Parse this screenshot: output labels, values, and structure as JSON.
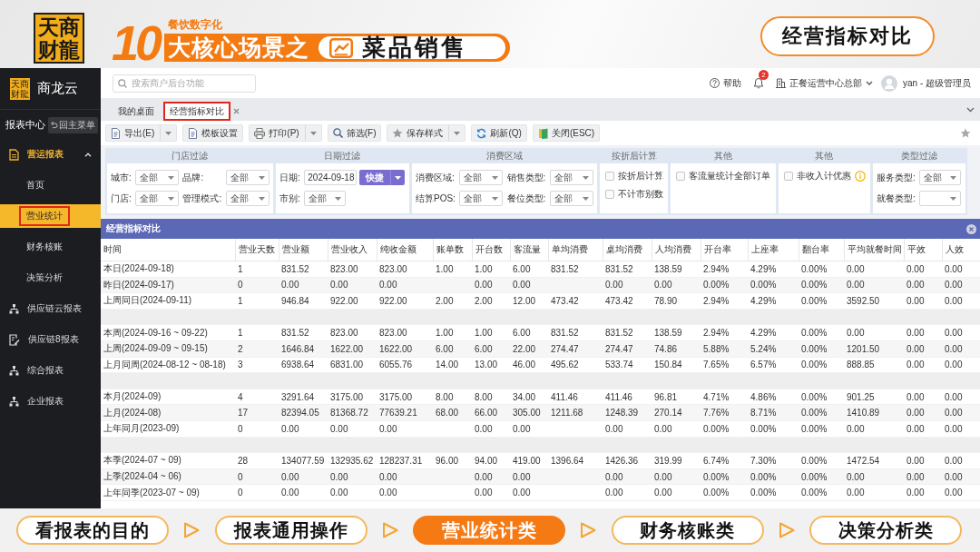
{
  "banner": {
    "logo_lines": [
      "天商",
      "财龍"
    ],
    "kicker": "餐饮数字化",
    "number": "10",
    "headline": "大核心场景之",
    "topic": "菜品销售",
    "badge": "经营指标对比"
  },
  "sidebar": {
    "logo_lines": [
      "天商",
      "财龍"
    ],
    "brand": "商龙云",
    "section_title": "报表中心",
    "back_button": "回主菜单",
    "items": [
      {
        "label": "营运报表",
        "kind": "report",
        "expanded": true,
        "children": [
          {
            "label": "首页",
            "selected": false,
            "highlighted": false
          },
          {
            "label": "营业统计",
            "selected": true,
            "highlighted": true
          },
          {
            "label": "财务核账",
            "selected": false,
            "highlighted": false
          },
          {
            "label": "决策分析",
            "selected": false,
            "highlighted": false
          }
        ]
      },
      {
        "label": "供应链云报表",
        "kind": "tree",
        "expanded": false
      },
      {
        "label": "供应链8报表",
        "kind": "form",
        "expanded": false
      },
      {
        "label": "综合报表",
        "kind": "tree",
        "expanded": false
      },
      {
        "label": "企业报表",
        "kind": "tree",
        "expanded": false
      }
    ]
  },
  "header": {
    "search": {
      "placeholder": "搜索商户后台功能"
    },
    "help": "帮助",
    "notifications": "2",
    "organization": "正餐运营中心总部",
    "user": "yan - 超级管理员"
  },
  "tabs": [
    {
      "label": "我的桌面",
      "selected": false,
      "highlighted": false
    },
    {
      "label": "经营指标对比",
      "selected": true,
      "highlighted": true
    }
  ],
  "toolbar": [
    {
      "label": "导出(E)",
      "kind": "export",
      "dropdown": true
    },
    {
      "label": "模板设置",
      "kind": "template",
      "dropdown": false
    },
    {
      "label": "打印(P)",
      "kind": "print",
      "dropdown": true
    },
    {
      "label": "筛选(F)",
      "kind": "filter",
      "dropdown": false
    },
    {
      "label": "保存样式",
      "kind": "save",
      "dropdown": true
    },
    {
      "label": "刷新(Q)",
      "kind": "refresh",
      "dropdown": false
    },
    {
      "label": "关闭(ESC)",
      "kind": "close",
      "dropdown": false
    }
  ],
  "filters": [
    {
      "title": "门店过滤",
      "fields": [
        {
          "kind": "select",
          "label": "城市:",
          "value": "全部"
        },
        {
          "kind": "select",
          "label": "品牌:",
          "value": "全部"
        },
        {
          "kind": "select",
          "label": "门店:",
          "value": "全部"
        },
        {
          "kind": "select",
          "label": "管理模式:",
          "value": "全部"
        }
      ]
    },
    {
      "title": "日期过滤",
      "fields": [
        {
          "kind": "date",
          "label": "日期:",
          "value": "2024-09-18",
          "button": "快捷"
        },
        {
          "kind": "select",
          "label": "市别:",
          "value": "全部"
        }
      ]
    },
    {
      "title": "消费区域",
      "fields": [
        {
          "kind": "select",
          "label": "消费区域:",
          "value": "全部"
        },
        {
          "kind": "select",
          "label": "销售类型:",
          "value": "全部"
        },
        {
          "kind": "select",
          "label": "结算POS:",
          "value": "全部"
        },
        {
          "kind": "select",
          "label": "餐位类型:",
          "value": "全部"
        }
      ]
    },
    {
      "title": "按折后计算",
      "fields": [
        {
          "kind": "checkbox",
          "label": "按折后计算",
          "checked": false
        },
        {
          "kind": "checkbox",
          "label": "不计市别数",
          "checked": false
        }
      ]
    },
    {
      "title": "其他",
      "fields": [
        {
          "kind": "checkbox",
          "label": "客流量统计全部订单",
          "checked": false
        }
      ]
    },
    {
      "title": "其他",
      "fields": [
        {
          "kind": "checkbox",
          "label": "非收入计优惠",
          "checked": false,
          "info": true
        }
      ]
    },
    {
      "title": "类型过滤",
      "fields": [
        {
          "kind": "select",
          "label": "服务类型:",
          "value": "全部"
        },
        {
          "kind": "select",
          "label": "就餐类型:"
        }
      ]
    }
  ],
  "table": {
    "title": "经营指标对比",
    "columns": [
      "时间",
      "营业天数",
      "营业额",
      "营业收入",
      "纯收金额",
      "账单数",
      "开台数",
      "客流量",
      "单均消费",
      "桌均消费",
      "人均消费",
      "开台率",
      "上座率",
      "翻台率",
      "平均就餐时间",
      "平效",
      "人效"
    ],
    "row_groups": [
      [
        {
          "time": "本日(2024-09-18)",
          "days": "1",
          "sales": "831.52",
          "income": "823.00",
          "net": "823.00",
          "bills": "1.00",
          "tables": "1.00",
          "guests": "6.00",
          "per_bill": "831.52",
          "per_table": "831.52",
          "per_guest": "138.59",
          "open_rate": "2.94%",
          "seat_rate": "4.29%",
          "turn_rate": "0.00%",
          "dining_time": "0.00",
          "area_eff": "0.00",
          "staff_eff": "0.00"
        },
        {
          "time": "昨日(2024-09-17)",
          "days": "0",
          "sales": "0.00",
          "income": "0.00",
          "net": "0.00",
          "tables": "0.00",
          "guests": "0.00",
          "per_table": "0.00",
          "per_guest": "0.00",
          "open_rate": "0.00%",
          "seat_rate": "0.00%",
          "turn_rate": "0.00%",
          "dining_time": "0.00",
          "area_eff": "0.00",
          "staff_eff": "0.00"
        },
        {
          "time": "上周同日(2024-09-11)",
          "days": "1",
          "sales": "946.84",
          "income": "922.00",
          "net": "922.00",
          "bills": "2.00",
          "tables": "2.00",
          "guests": "12.00",
          "per_bill": "473.42",
          "per_table": "473.42",
          "per_guest": "78.90",
          "open_rate": "2.94%",
          "seat_rate": "4.29%",
          "turn_rate": "0.00%",
          "dining_time": "3592.50",
          "area_eff": "0.00",
          "staff_eff": "0.00"
        }
      ],
      [
        {
          "time": "本周(2024-09-16 ~ 09-22)",
          "days": "1",
          "sales": "831.52",
          "income": "823.00",
          "net": "823.00",
          "bills": "1.00",
          "tables": "1.00",
          "guests": "6.00",
          "per_bill": "831.52",
          "per_table": "831.52",
          "per_guest": "138.59",
          "open_rate": "2.94%",
          "seat_rate": "4.29%",
          "turn_rate": "0.00%",
          "dining_time": "0.00",
          "area_eff": "0.00",
          "staff_eff": "0.00"
        },
        {
          "time": "上周(2024-09-09 ~ 09-15)",
          "days": "2",
          "sales": "1646.84",
          "income": "1622.00",
          "net": "1622.00",
          "bills": "6.00",
          "tables": "6.00",
          "guests": "22.00",
          "per_bill": "274.47",
          "per_table": "274.47",
          "per_guest": "74.86",
          "open_rate": "5.88%",
          "seat_rate": "5.24%",
          "turn_rate": "0.00%",
          "dining_time": "1201.50",
          "area_eff": "0.00",
          "staff_eff": "0.00"
        },
        {
          "time": "上月同周(2024-08-12 ~ 08-18)",
          "days": "3",
          "sales": "6938.64",
          "income": "6831.00",
          "net": "6055.76",
          "bills": "14.00",
          "tables": "13.00",
          "guests": "46.00",
          "per_bill": "495.62",
          "per_table": "533.74",
          "per_guest": "150.84",
          "open_rate": "7.65%",
          "seat_rate": "6.57%",
          "turn_rate": "0.00%",
          "dining_time": "888.85",
          "area_eff": "0.00",
          "staff_eff": "0.00"
        }
      ],
      [
        {
          "time": "本月(2024-09)",
          "days": "4",
          "sales": "3291.64",
          "income": "3175.00",
          "net": "3175.00",
          "bills": "8.00",
          "tables": "8.00",
          "guests": "34.00",
          "per_bill": "411.46",
          "per_table": "411.46",
          "per_guest": "96.81",
          "open_rate": "4.71%",
          "seat_rate": "4.86%",
          "turn_rate": "0.00%",
          "dining_time": "901.25",
          "area_eff": "0.00",
          "staff_eff": "0.00"
        },
        {
          "time": "上月(2024-08)",
          "days": "17",
          "sales": "82394.05",
          "income": "81368.72",
          "net": "77639.21",
          "bills": "68.00",
          "tables": "66.00",
          "guests": "305.00",
          "per_bill": "1211.68",
          "per_table": "1248.39",
          "per_guest": "270.14",
          "open_rate": "7.76%",
          "seat_rate": "8.71%",
          "turn_rate": "0.00%",
          "dining_time": "1410.89",
          "area_eff": "0.00",
          "staff_eff": "0.00"
        },
        {
          "time": "上年同月(2023-09)",
          "days": "0",
          "sales": "0.00",
          "income": "0.00",
          "net": "0.00",
          "tables": "0.00",
          "guests": "0.00",
          "per_table": "0.00",
          "per_guest": "0.00",
          "open_rate": "0.00%",
          "seat_rate": "0.00%",
          "turn_rate": "0.00%",
          "dining_time": "0.00",
          "area_eff": "0.00",
          "staff_eff": "0.00"
        }
      ],
      [
        {
          "time": "本季(2024-07 ~ 09)",
          "days": "28",
          "sales": "134077.59",
          "income": "132935.62",
          "net": "128237.31",
          "bills": "96.00",
          "tables": "94.00",
          "guests": "419.00",
          "per_bill": "1396.64",
          "per_table": "1426.36",
          "per_guest": "319.99",
          "open_rate": "6.74%",
          "seat_rate": "7.30%",
          "turn_rate": "0.00%",
          "dining_time": "1472.54",
          "area_eff": "0.00",
          "staff_eff": "0.00"
        },
        {
          "time": "上季(2024-04 ~ 06)",
          "days": "0",
          "sales": "0.00",
          "income": "0.00",
          "net": "0.00",
          "tables": "0.00",
          "guests": "0.00",
          "per_table": "0.00",
          "per_guest": "0.00",
          "open_rate": "0.00%",
          "seat_rate": "0.00%",
          "turn_rate": "0.00%",
          "dining_time": "0.00",
          "area_eff": "0.00",
          "staff_eff": "0.00"
        },
        {
          "time": "上年同季(2023-07 ~ 09)",
          "days": "0",
          "sales": "0.00",
          "income": "0.00",
          "net": "0.00",
          "tables": "0.00",
          "guests": "0.00",
          "per_table": "0.00",
          "per_guest": "0.00",
          "open_rate": "0.00%",
          "seat_rate": "0.00%",
          "turn_rate": "0.00%",
          "dining_time": "0.00",
          "area_eff": "0.00",
          "staff_eff": "0.00"
        }
      ]
    ]
  },
  "steps": [
    {
      "label": "看报表的目的",
      "selected": false
    },
    {
      "label": "报表通用操作",
      "selected": false
    },
    {
      "label": "营业统计类",
      "selected": true
    },
    {
      "label": "财务核账类",
      "selected": false
    },
    {
      "label": "决策分析类",
      "selected": false
    }
  ]
}
